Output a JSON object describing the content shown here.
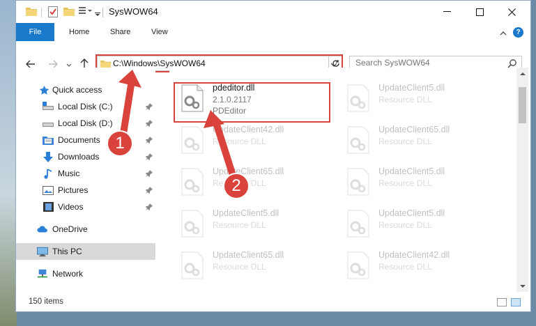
{
  "window": {
    "title": "SysWOW64"
  },
  "ribbon": {
    "tabs": [
      "File",
      "Home",
      "Share",
      "View"
    ],
    "help": "?"
  },
  "address": {
    "path": "C:\\Windows\\SysWOW64"
  },
  "search": {
    "placeholder": "Search SysWOW64"
  },
  "nav": {
    "items": [
      {
        "label": "Quick access",
        "icon": "star-icon"
      },
      {
        "label": "Local Disk (C:)",
        "icon": "drive-icon"
      },
      {
        "label": "Local Disk (D:)",
        "icon": "drive-icon"
      },
      {
        "label": "Documents",
        "icon": "documents-icon"
      },
      {
        "label": "Downloads",
        "icon": "download-icon"
      },
      {
        "label": "Music",
        "icon": "music-icon"
      },
      {
        "label": "Pictures",
        "icon": "pictures-icon"
      },
      {
        "label": "Videos",
        "icon": "videos-icon"
      },
      {
        "label": "OneDrive",
        "icon": "cloud-icon"
      },
      {
        "label": "This PC",
        "icon": "computer-icon"
      },
      {
        "label": "Network",
        "icon": "network-icon"
      }
    ]
  },
  "files": {
    "highlighted": {
      "name": "pdeditor.dll",
      "version": "2.1.0.2117",
      "description": "PDEditor"
    },
    "others": [
      {
        "name": "UpdateClient5.dll",
        "description": "Resource DLL"
      },
      {
        "name": "UpdateClient42.dll",
        "description": "Resource DLL"
      },
      {
        "name": "UpdateClient65.dll",
        "description": "Resource DLL"
      },
      {
        "name": "UpdateClient65.dll",
        "description": "Resource DLL"
      },
      {
        "name": "UpdateClient5.dll",
        "description": "Resource DLL"
      },
      {
        "name": "UpdateClient5.dll",
        "description": "Resource DLL"
      },
      {
        "name": "UpdateClient5.dll",
        "description": "Resource DLL"
      },
      {
        "name": "UpdateClient65.dll",
        "description": "Resource DLL"
      },
      {
        "name": "UpdateClient42.dll",
        "description": "Resource DLL"
      }
    ]
  },
  "status": {
    "item_count": "150 items"
  },
  "annotations": {
    "step1": "1",
    "step2": "2",
    "color": "#d9433b"
  },
  "colors": {
    "accent": "#1979ca"
  }
}
